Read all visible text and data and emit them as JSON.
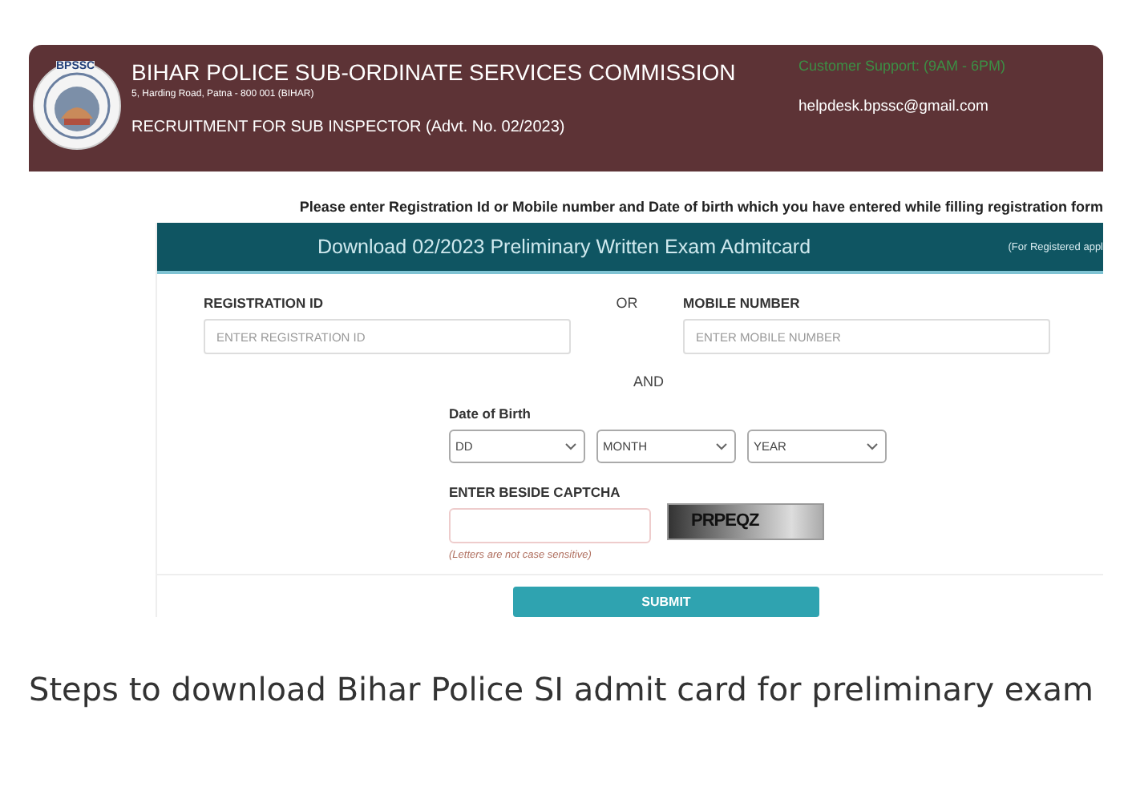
{
  "header": {
    "logo_text": "BPSSC",
    "title": "BIHAR POLICE SUB-ORDINATE SERVICES COMMISSION",
    "address": "5, Harding Road, Patna - 800 001 (BIHAR)",
    "recruitment": "RECRUITMENT FOR SUB INSPECTOR (Advt. No. 02/2023)",
    "support": "Customer Support: (9AM - 6PM)",
    "email": "helpdesk.bpssc@gmail.com"
  },
  "instruction": "Please enter Registration Id or Mobile number and Date of birth which you have entered while filling registration form",
  "form": {
    "title": "Download 02/2023 Preliminary Written Exam Admitcard",
    "title_note": "(For Registered appl",
    "registration": {
      "label": "REGISTRATION ID",
      "placeholder": "ENTER REGISTRATION ID"
    },
    "or": "OR",
    "mobile": {
      "label": "MOBILE NUMBER",
      "placeholder": "ENTER MOBILE NUMBER"
    },
    "and": "AND",
    "dob_label": "Date of Birth",
    "dob_selects": [
      {
        "value": "DD"
      },
      {
        "value": "MONTH"
      },
      {
        "value": "YEAR"
      }
    ],
    "captcha_label": "ENTER BESIDE CAPTCHA",
    "captcha_text": "PRPEQZ",
    "captcha_note": "(Letters are not case sensitive)",
    "submit": "SUBMIT"
  },
  "caption": "Steps to download Bihar Police SI admit card for preliminary exam"
}
